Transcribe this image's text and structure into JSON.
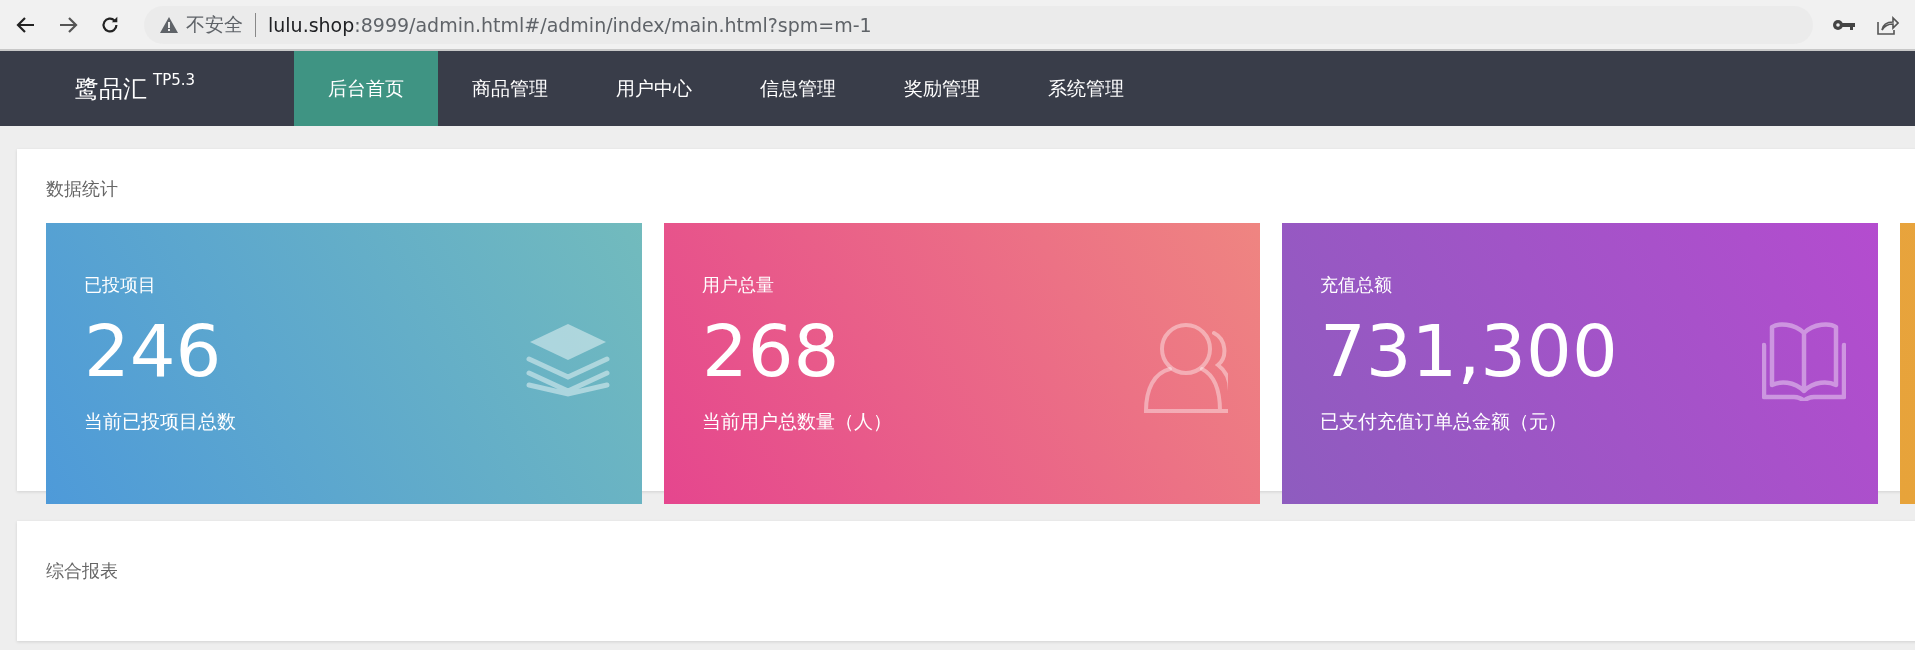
{
  "browser": {
    "security_label": "不安全",
    "url_host": "lulu.shop",
    "url_path": ":8999/admin.html#/admin/index/main.html?spm=m-1"
  },
  "header": {
    "logo": "鹭品汇",
    "version": "TP5.3",
    "tabs": [
      {
        "label": "后台首页",
        "selected": true
      },
      {
        "label": "商品管理",
        "selected": false
      },
      {
        "label": "用户中心",
        "selected": false
      },
      {
        "label": "信息管理",
        "selected": false
      },
      {
        "label": "奖励管理",
        "selected": false
      },
      {
        "label": "系统管理",
        "selected": false
      }
    ]
  },
  "stats_panel": {
    "title": "数据统计",
    "cards": [
      {
        "kind": "layers",
        "label": "已投项目",
        "value": "246",
        "caption": "当前已投项目总数"
      },
      {
        "kind": "users",
        "label": "用户总量",
        "value": "268",
        "caption": "当前用户总数量（人）"
      },
      {
        "kind": "book",
        "label": "充值总额",
        "value": "731,300",
        "caption": "已支付充值订单总金额（元）"
      },
      {
        "kind": "partial"
      }
    ]
  },
  "report_panel": {
    "title": "综合报表"
  }
}
